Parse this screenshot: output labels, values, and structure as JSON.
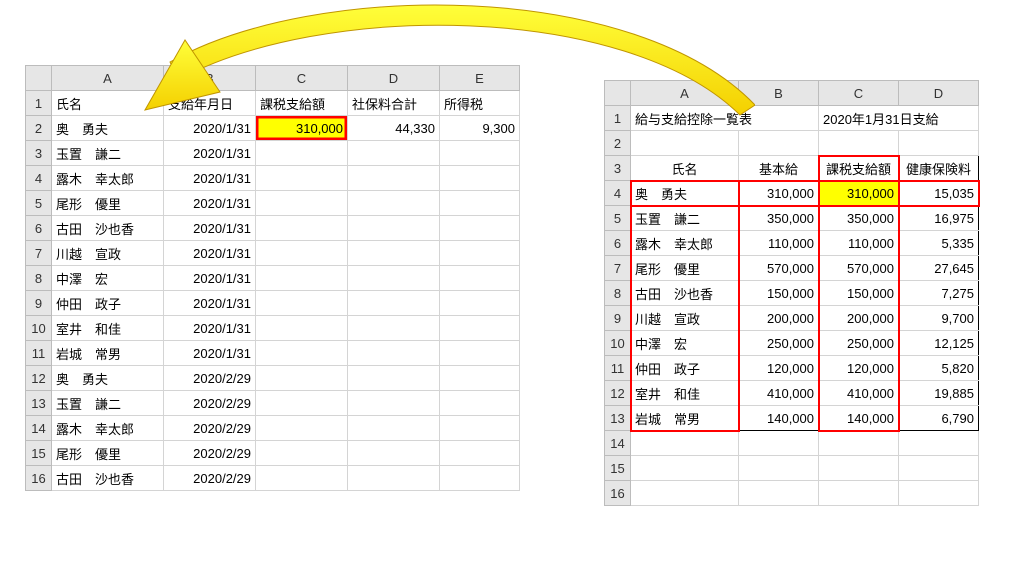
{
  "left": {
    "cols": [
      "A",
      "B",
      "C",
      "D",
      "E"
    ],
    "headers": {
      "A": "氏名",
      "B": "支給年月日",
      "C": "課税支給額",
      "D": "社保料合計",
      "E": "所得税"
    },
    "rows": [
      {
        "r": 2,
        "A": "奥　勇夫",
        "B": "2020/1/31",
        "C": "310,000",
        "D": "44,330",
        "E": "9,300"
      },
      {
        "r": 3,
        "A": "玉置　謙二",
        "B": "2020/1/31",
        "C": "",
        "D": "",
        "E": ""
      },
      {
        "r": 4,
        "A": "露木　幸太郎",
        "B": "2020/1/31",
        "C": "",
        "D": "",
        "E": ""
      },
      {
        "r": 5,
        "A": "尾形　優里",
        "B": "2020/1/31",
        "C": "",
        "D": "",
        "E": ""
      },
      {
        "r": 6,
        "A": "古田　沙也香",
        "B": "2020/1/31",
        "C": "",
        "D": "",
        "E": ""
      },
      {
        "r": 7,
        "A": "川越　宣政",
        "B": "2020/1/31",
        "C": "",
        "D": "",
        "E": ""
      },
      {
        "r": 8,
        "A": "中澤　宏",
        "B": "2020/1/31",
        "C": "",
        "D": "",
        "E": ""
      },
      {
        "r": 9,
        "A": "仲田　政子",
        "B": "2020/1/31",
        "C": "",
        "D": "",
        "E": ""
      },
      {
        "r": 10,
        "A": "室井　和佳",
        "B": "2020/1/31",
        "C": "",
        "D": "",
        "E": ""
      },
      {
        "r": 11,
        "A": "岩城　常男",
        "B": "2020/1/31",
        "C": "",
        "D": "",
        "E": ""
      },
      {
        "r": 12,
        "A": "奥　勇夫",
        "B": "2020/2/29",
        "C": "",
        "D": "",
        "E": ""
      },
      {
        "r": 13,
        "A": "玉置　謙二",
        "B": "2020/2/29",
        "C": "",
        "D": "",
        "E": ""
      },
      {
        "r": 14,
        "A": "露木　幸太郎",
        "B": "2020/2/29",
        "C": "",
        "D": "",
        "E": ""
      },
      {
        "r": 15,
        "A": "尾形　優里",
        "B": "2020/2/29",
        "C": "",
        "D": "",
        "E": ""
      },
      {
        "r": 16,
        "A": "古田　沙也香",
        "B": "2020/2/29",
        "C": "",
        "D": "",
        "E": ""
      }
    ]
  },
  "right": {
    "cols": [
      "A",
      "B",
      "C",
      "D"
    ],
    "title_row": {
      "A": "給与支給控除一覧表",
      "C": "2020年1月31日支給"
    },
    "headers": {
      "A": "氏名",
      "B": "基本給",
      "C": "課税支給額",
      "D": "健康保険料"
    },
    "rows": [
      {
        "r": 4,
        "A": "奥　勇夫",
        "B": "310,000",
        "C": "310,000",
        "D": "15,035"
      },
      {
        "r": 5,
        "A": "玉置　謙二",
        "B": "350,000",
        "C": "350,000",
        "D": "16,975"
      },
      {
        "r": 6,
        "A": "露木　幸太郎",
        "B": "110,000",
        "C": "110,000",
        "D": "5,335"
      },
      {
        "r": 7,
        "A": "尾形　優里",
        "B": "570,000",
        "C": "570,000",
        "D": "27,645"
      },
      {
        "r": 8,
        "A": "古田　沙也香",
        "B": "150,000",
        "C": "150,000",
        "D": "7,275"
      },
      {
        "r": 9,
        "A": "川越　宣政",
        "B": "200,000",
        "C": "200,000",
        "D": "9,700"
      },
      {
        "r": 10,
        "A": "中澤　宏",
        "B": "250,000",
        "C": "250,000",
        "D": "12,125"
      },
      {
        "r": 11,
        "A": "仲田　政子",
        "B": "120,000",
        "C": "120,000",
        "D": "5,820"
      },
      {
        "r": 12,
        "A": "室井　和佳",
        "B": "410,000",
        "C": "410,000",
        "D": "19,885"
      },
      {
        "r": 13,
        "A": "岩城　常男",
        "B": "140,000",
        "C": "140,000",
        "D": "6,790"
      }
    ],
    "empty_rows": [
      14,
      15,
      16
    ]
  }
}
